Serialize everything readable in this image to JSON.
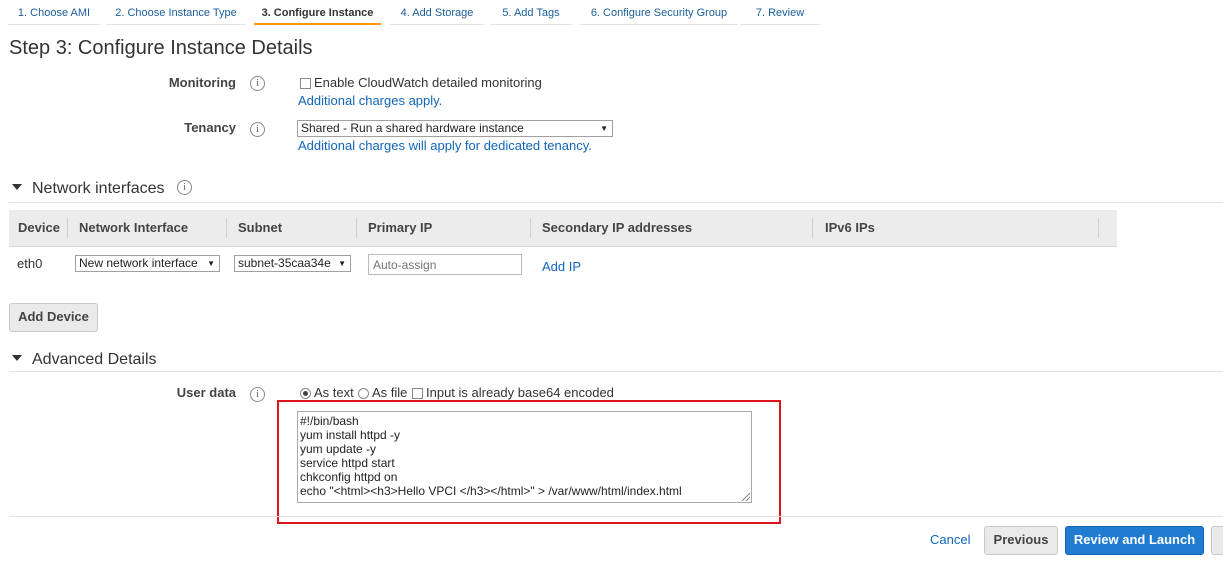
{
  "wizard": {
    "tabs": [
      {
        "label": "1. Choose AMI"
      },
      {
        "label": "2. Choose Instance Type"
      },
      {
        "label": "3. Configure Instance"
      },
      {
        "label": "4. Add Storage"
      },
      {
        "label": "5. Add Tags"
      },
      {
        "label": "6. Configure Security Group"
      },
      {
        "label": "7. Review"
      }
    ],
    "active_tab": "3. Configure Instance"
  },
  "page_title": "Step 3: Configure Instance Details",
  "monitoring": {
    "label": "Monitoring",
    "checkbox_label": "Enable CloudWatch detailed monitoring",
    "checked": false,
    "note_link": "Additional charges apply."
  },
  "tenancy": {
    "label": "Tenancy",
    "selected": "Shared - Run a shared hardware instance",
    "note_link": "Additional charges will apply for dedicated tenancy."
  },
  "network_interfaces": {
    "heading": "Network interfaces",
    "columns": [
      "Device",
      "Network Interface",
      "Subnet",
      "Primary IP",
      "Secondary IP addresses",
      "IPv6 IPs"
    ],
    "rows": [
      {
        "device": "eth0",
        "network_interface": "New network interface",
        "subnet": "subnet-35caa34e",
        "primary_ip_placeholder": "Auto-assign",
        "secondary_action": "Add IP"
      }
    ],
    "add_device_label": "Add Device"
  },
  "advanced": {
    "heading": "Advanced Details",
    "user_data_label": "User data",
    "options": {
      "as_text": "As text",
      "as_file": "As file",
      "base64": "Input is already base64 encoded"
    },
    "selected_option": "As text",
    "script_lines": [
      "#!/bin/bash",
      "yum install httpd -y",
      "yum update -y",
      "service httpd start",
      "chkconfig httpd on",
      "echo \"<html><h3>Hello VPCI </h3></html>\" > /var/www/html/index.html"
    ]
  },
  "footer": {
    "cancel": "Cancel",
    "previous": "Previous",
    "review_launch": "Review and Launch"
  },
  "colors": {
    "link": "#1166bb",
    "active_tab_underline": "#ff9900",
    "primary_button": "#1f7cd1",
    "highlight_box": "#e0151b"
  }
}
